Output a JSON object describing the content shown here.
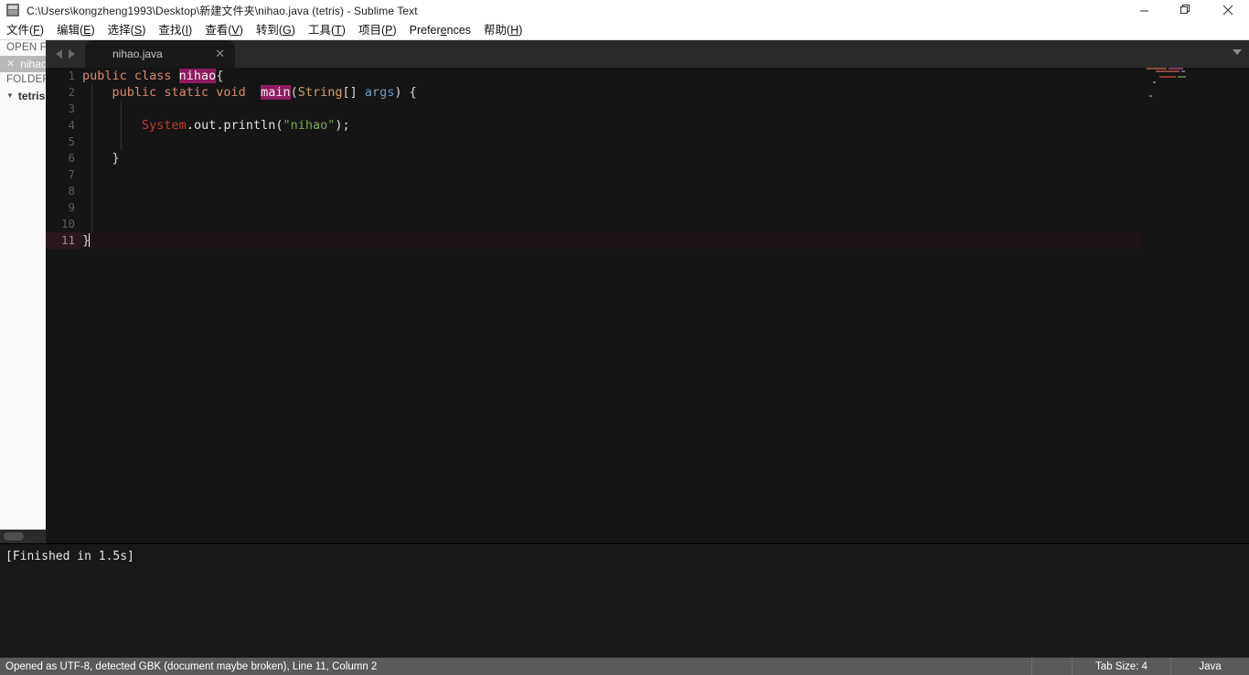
{
  "window": {
    "title": "C:\\Users\\kongzheng1993\\Desktop\\新建文件夹\\nihao.java (tetris) - Sublime Text",
    "icon": "sublime-text-icon",
    "controls": {
      "minimize": "minimize-icon",
      "restore": "restore-icon",
      "close": "close-icon"
    }
  },
  "menubar": {
    "items": [
      {
        "label": "文件",
        "accel": "F"
      },
      {
        "label": "编辑",
        "accel": "E"
      },
      {
        "label": "选择",
        "accel": "S"
      },
      {
        "label": "查找",
        "accel": "I"
      },
      {
        "label": "查看",
        "accel": "V"
      },
      {
        "label": "转到",
        "accel": "G"
      },
      {
        "label": "工具",
        "accel": "T"
      },
      {
        "label": "项目",
        "accel": "P"
      },
      {
        "label": "Preferences",
        "accel": ""
      },
      {
        "label": "帮助",
        "accel": "H"
      }
    ]
  },
  "sidebar": {
    "open_files_header": "OPEN FILES",
    "open_files": [
      {
        "name": "nihao.java",
        "close_icon": "close-icon",
        "selected": true
      }
    ],
    "folders_header": "FOLDERS",
    "folders": [
      {
        "name": "tetris",
        "expanded": true,
        "chevron": "triangle-down-icon"
      }
    ],
    "hscroll": "horizontal-scrollbar"
  },
  "tabs": {
    "nav_prev_icon": "chevron-left-icon",
    "nav_next_icon": "chevron-right-icon",
    "overflow_icon": "chevron-down-icon",
    "items": [
      {
        "label": "nihao.java",
        "active": true,
        "close_icon": "close-icon"
      }
    ]
  },
  "editor": {
    "language": "Java",
    "cursor_line": 11,
    "cursor_column": 2,
    "lines": [
      {
        "num": "1",
        "indent_guides": [],
        "tokens": [
          {
            "text": "public class ",
            "cls": "t-kw"
          },
          {
            "text": "nihao",
            "cls": "t-hl"
          },
          {
            "text": "{",
            "cls": "t-punc"
          }
        ]
      },
      {
        "num": "2",
        "indent_guides": [
          1
        ],
        "tokens": [
          {
            "text": "    public static void ",
            "cls": "t-kw"
          },
          {
            "text": " ",
            "cls": "t-plain"
          },
          {
            "text": "main",
            "cls": "t-hl"
          },
          {
            "text": "(",
            "cls": "t-punc"
          },
          {
            "text": "String",
            "cls": "t-type"
          },
          {
            "text": "[] ",
            "cls": "t-punc"
          },
          {
            "text": "args",
            "cls": "t-var"
          },
          {
            "text": ") {",
            "cls": "t-punc"
          }
        ]
      },
      {
        "num": "3",
        "indent_guides": [
          1,
          2
        ],
        "tokens": []
      },
      {
        "num": "4",
        "indent_guides": [
          1,
          2
        ],
        "tokens": [
          {
            "text": "        ",
            "cls": "t-plain"
          },
          {
            "text": "System",
            "cls": "t-cls"
          },
          {
            "text": ".out.println(",
            "cls": "t-plain"
          },
          {
            "text": "\"nihao\"",
            "cls": "t-str"
          },
          {
            "text": ");",
            "cls": "t-plain"
          }
        ]
      },
      {
        "num": "5",
        "indent_guides": [
          1,
          2
        ],
        "tokens": []
      },
      {
        "num": "6",
        "indent_guides": [
          1
        ],
        "tokens": [
          {
            "text": "    }",
            "cls": "t-punc"
          }
        ]
      },
      {
        "num": "7",
        "indent_guides": [
          1
        ],
        "tokens": []
      },
      {
        "num": "8",
        "indent_guides": [
          1
        ],
        "tokens": []
      },
      {
        "num": "9",
        "indent_guides": [
          1
        ],
        "tokens": []
      },
      {
        "num": "10",
        "indent_guides": [
          1
        ],
        "tokens": []
      },
      {
        "num": "11",
        "current": true,
        "indent_guides": [],
        "tokens": [
          {
            "text": "}",
            "cls": "t-punc"
          }
        ],
        "caret_after": true
      }
    ]
  },
  "minimap": {
    "name": "code-minimap",
    "rows": [
      [
        {
          "w": 22,
          "c": "#8a4a3a"
        },
        {
          "w": 16,
          "c": "#7d3a5e"
        }
      ],
      [
        {
          "w": 8,
          "c": "#151515"
        },
        {
          "w": 26,
          "c": "#8a4a3a"
        },
        {
          "w": 4,
          "c": "#5c6f8c"
        }
      ],
      [],
      [
        {
          "w": 12,
          "c": "#151515"
        },
        {
          "w": 18,
          "c": "#8a3a32"
        },
        {
          "w": 9,
          "c": "#4f6b3a"
        }
      ],
      [],
      [
        {
          "w": 5,
          "c": "#151515"
        },
        {
          "w": 3,
          "c": "#6a6a6a"
        }
      ],
      [],
      [],
      [],
      [],
      [
        {
          "w": 1,
          "c": "#151515"
        },
        {
          "w": 3,
          "c": "#6a6a6a"
        }
      ]
    ]
  },
  "output": {
    "text": "[Finished in 1.5s]"
  },
  "statusbar": {
    "left": "Opened as UTF-8, detected GBK (document maybe broken), Line 11, Column 2",
    "tab_size": "Tab Size: 4",
    "language": "Java"
  },
  "colors": {
    "titlebar_bg": "#ffffff",
    "editor_bg": "#151515",
    "sidebar_bg": "#fafafa",
    "statusbar_bg": "#5a5a5a",
    "highlight_magenta": "#8e1b5e",
    "keyword": "#d88a6a",
    "string": "#7aa84f",
    "type": "#d4a264",
    "variable": "#6a9ec8",
    "class": "#c0392b"
  }
}
